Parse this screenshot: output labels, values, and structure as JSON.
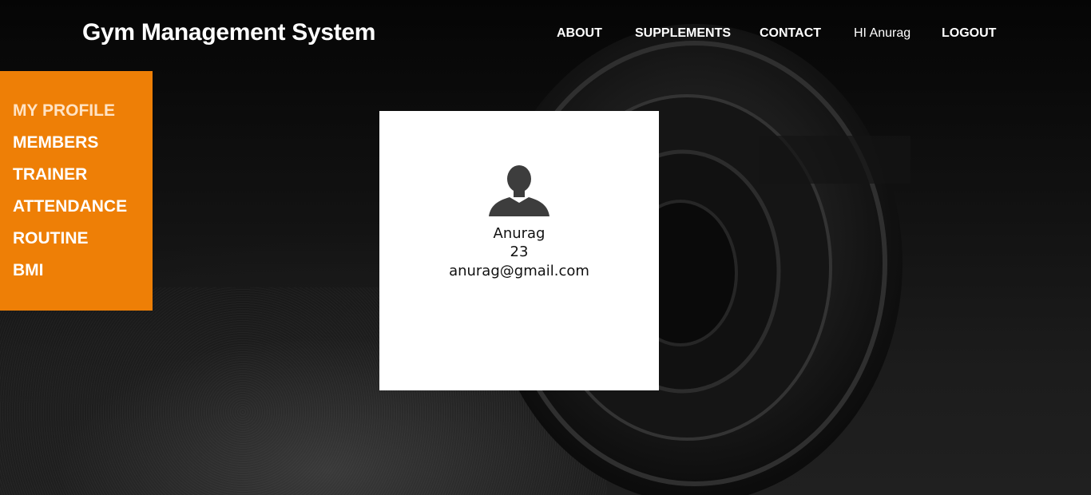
{
  "header": {
    "title": "Gym Management System",
    "nav": {
      "about": "ABOUT",
      "supplements": "SUPPLEMENTS",
      "contact": "CONTACT",
      "greeting": "HI Anurag",
      "logout": "LOGOUT"
    }
  },
  "sidebar": {
    "items": [
      {
        "label": "MY PROFILE",
        "active": true
      },
      {
        "label": "MEMBERS"
      },
      {
        "label": "TRAINER"
      },
      {
        "label": "ATTENDANCE"
      },
      {
        "label": "ROUTINE"
      },
      {
        "label": "BMI"
      }
    ],
    "accent_color": "#ee7f06"
  },
  "profile": {
    "avatar_icon": "user-silhouette-icon",
    "name": "Anurag",
    "age": "23",
    "email": "anurag@gmail.com"
  },
  "colors": {
    "background": "#111111",
    "card": "#ffffff",
    "accent": "#ee7f06"
  }
}
